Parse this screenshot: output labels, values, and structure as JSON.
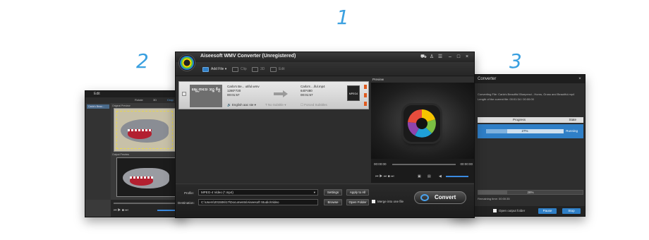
{
  "step_numbers": [
    "1",
    "2",
    "3"
  ],
  "main_window": {
    "title": "Aiseesoft WMV Converter (Unregistered)",
    "toolbar": {
      "add_file": "Add File",
      "clip": "Clip",
      "three_d": "3D",
      "edit": "Edit"
    },
    "file_row": {
      "thumb_text": "ᨳᩮ᩠ᨿᩬ ᨠᩈᩮ ᩈᩣ᩠ᨠ ᨧᩥᨾᩬ",
      "source_name": "Carla's Be... utiful.wmv",
      "source_resolution": "1280*720",
      "source_duration": "00:01:57",
      "output_name": "Carla's ...iful.mp4",
      "output_resolution": "640*480",
      "output_duration": "00:01:57",
      "format_icon": "MPEG4",
      "audio": "English aac ste",
      "subtitle": "No Subtitle",
      "forced": "Forced Subtitles"
    },
    "preview": {
      "label": "Preview",
      "time_start": "00:00:00",
      "time_end": "00:00:00"
    },
    "bottom": {
      "profile_label": "Profile:",
      "profile_value": "MPEG-4 Video (*.mp4)",
      "settings": "Settings",
      "apply_all": "Apply to All",
      "destination_label": "Destination:",
      "destination_value": "C:\\Users\\201506\\17\\Documents\\Aiseesoft Studio\\Video",
      "browse": "Browse",
      "open_folder": "Open Folder",
      "merge": "Merge into one file",
      "convert": "Convert"
    }
  },
  "edit_window": {
    "title": "Edit",
    "tabs": [
      "Rotate",
      "3D",
      "Crop"
    ],
    "sidebar_item": "Carla's Beau...",
    "original_label": "Original Preview",
    "output_label": "Output Preview"
  },
  "progress_window": {
    "title": "Converter",
    "info_line1": "Converting File: Carla's Beautiful Bluepenci - Horns, Gross and Beautiful.mp4",
    "info_line2": "Length of the current file: 00:01:34 / 00:00:00",
    "col_progress": "Progress",
    "col_state": "State",
    "row_progress": 27,
    "row_progress_text": "27%",
    "row_state": "Running",
    "overall_progress": 28,
    "overall_text": "28%",
    "remaining": "Remaining time: 00:00:35",
    "open_output": "Open output folder",
    "pause": "Pause",
    "stop": "Stop"
  }
}
